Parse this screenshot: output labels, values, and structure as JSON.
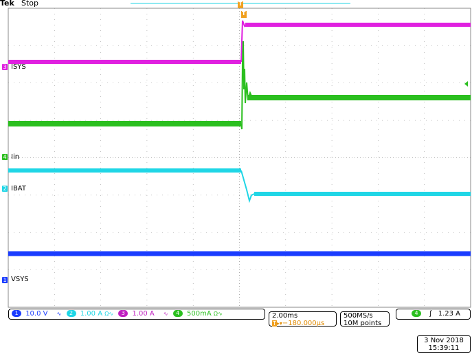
{
  "header": {
    "brand": "Tek",
    "state": "Stop"
  },
  "trace_labels": {
    "ch3": {
      "num": "3",
      "name": "ISYS",
      "color": "#e020e0"
    },
    "ch4": {
      "num": "4",
      "name": "Iin",
      "color": "#2bbf1f"
    },
    "ch2": {
      "num": "2",
      "name": "IBAT",
      "color": "#1fd6e6"
    },
    "ch1": {
      "num": "1",
      "name": "VSYS",
      "color": "#1a3cff"
    }
  },
  "trigger_marker": "T",
  "channels": [
    {
      "num": "1",
      "scale": "10.0 V",
      "coupling": "∿",
      "color": "#1a3cff"
    },
    {
      "num": "2",
      "scale": "1.00 A",
      "coupling": "Ω∿",
      "color": "#1fd6e6"
    },
    {
      "num": "3",
      "scale": "1.00 A",
      "coupling": "∿",
      "color": "#c020c0"
    },
    {
      "num": "4",
      "scale": "500mA",
      "coupling": "Ω∿",
      "color": "#2bbf1f"
    }
  ],
  "timebase": {
    "scale": "2.00ms",
    "position": "−180.000µs",
    "pos_marker": "T"
  },
  "acquisition": {
    "rate": "500MS/s",
    "points": "10M points"
  },
  "trigger": {
    "source": "4",
    "slope": "ʃ",
    "level": "1.23 A"
  },
  "datetime": {
    "date": "3 Nov 2018",
    "time": "15:39:11"
  }
}
